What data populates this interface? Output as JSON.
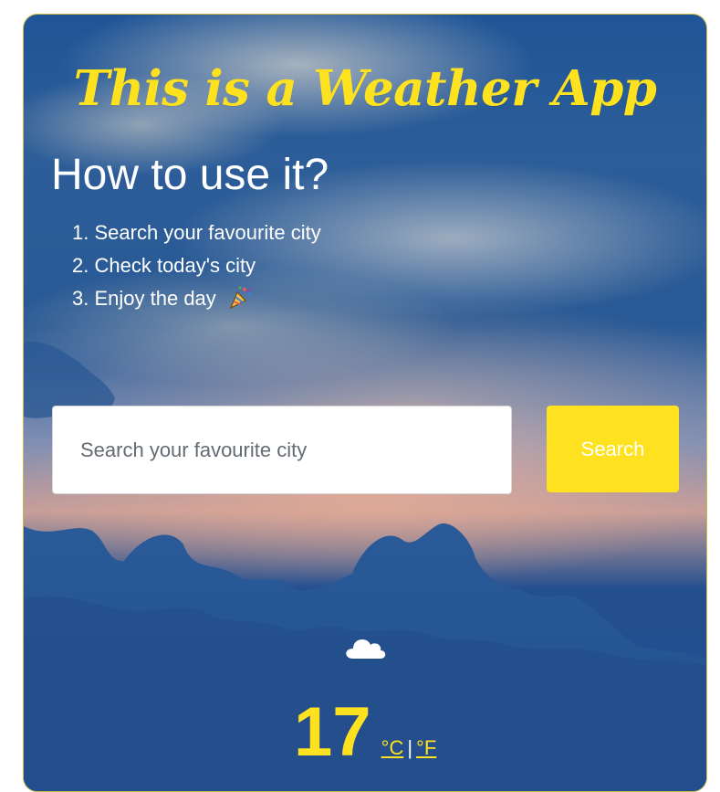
{
  "app": {
    "title": "This is a Weather App",
    "accent_color": "#ffe21f",
    "background_image": "sunset-sky-clouds"
  },
  "instructions": {
    "heading": "How to use it?",
    "steps": [
      {
        "number": "1.",
        "text": "Search your favourite city"
      },
      {
        "number": "2.",
        "text": "Check today's city"
      },
      {
        "number": "3.",
        "text": "Enjoy the day",
        "icon": "party-popper-icon"
      }
    ]
  },
  "search": {
    "value": "",
    "placeholder": "Search your favourite city",
    "button_label": "Search"
  },
  "weather": {
    "icon": "cloud-icon",
    "temperature": "17",
    "unit_celsius": "°C",
    "unit_separator": "|",
    "unit_fahrenheit": "°F"
  }
}
